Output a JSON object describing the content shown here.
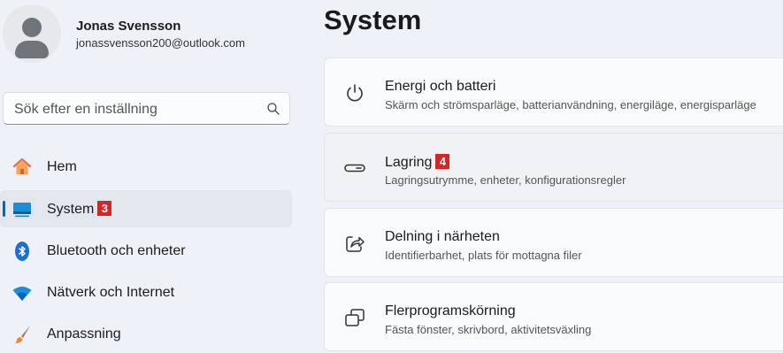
{
  "user": {
    "name": "Jonas Svensson",
    "email": "jonassvensson200@outlook.com"
  },
  "search": {
    "placeholder": "Sök efter en inställning",
    "icon": "search-icon"
  },
  "nav": {
    "items": [
      {
        "label": "Hem",
        "icon": "home-icon",
        "badge": ""
      },
      {
        "label": "System",
        "icon": "system-display-icon",
        "badge": "3",
        "active": true
      },
      {
        "label": "Bluetooth och enheter",
        "icon": "bluetooth-icon",
        "badge": ""
      },
      {
        "label": "Nätverk och Internet",
        "icon": "wifi-icon",
        "badge": ""
      },
      {
        "label": "Anpassning",
        "icon": "brush-icon",
        "badge": ""
      }
    ]
  },
  "main": {
    "title": "System",
    "cards": [
      {
        "title": "Energi och batteri",
        "subtitle": "Skärm och strömsparläge, batterianvändning, energiläge, energisparläge",
        "icon": "power-icon",
        "badge": ""
      },
      {
        "title": "Lagring",
        "subtitle": "Lagringsutrymme, enheter, konfigurationsregler",
        "icon": "storage-drive-icon",
        "badge": "4"
      },
      {
        "title": "Delning i närheten",
        "subtitle": "Identifierbarhet, plats för mottagna filer",
        "icon": "share-icon",
        "badge": ""
      },
      {
        "title": "Flerprogramskörning",
        "subtitle": "Fästa fönster, skrivbord, aktivitetsväxling",
        "icon": "multitasking-icon",
        "badge": ""
      }
    ]
  },
  "colors": {
    "accent": "#0067c0",
    "badge": "#d32626",
    "background": "#eef2f8"
  }
}
